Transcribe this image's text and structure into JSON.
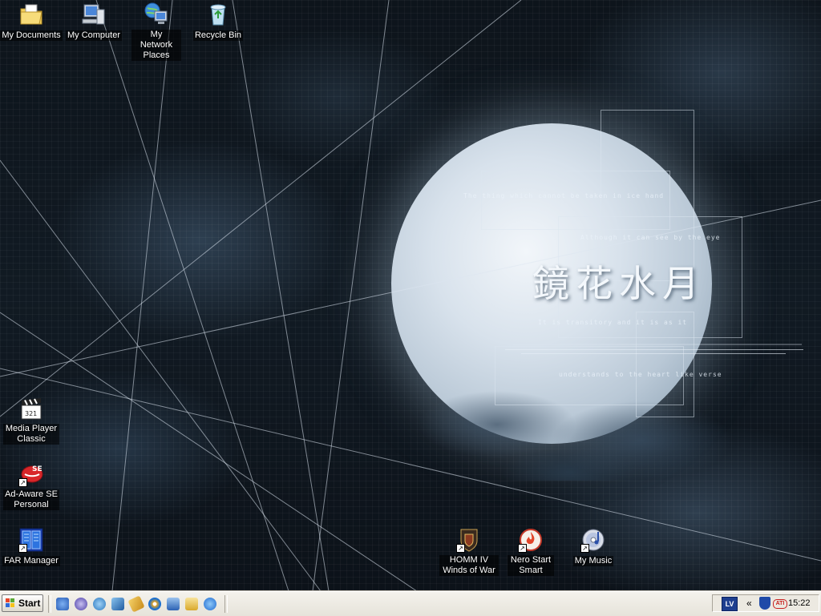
{
  "desktop": {
    "icons": [
      {
        "id": "my-documents",
        "label": "My Documents"
      },
      {
        "id": "my-computer",
        "label": "My Computer"
      },
      {
        "id": "my-network-places",
        "label": "My Network Places"
      },
      {
        "id": "recycle-bin",
        "label": "Recycle Bin"
      },
      {
        "id": "media-player-classic",
        "label": "Media Player Classic"
      },
      {
        "id": "ad-aware",
        "label": "Ad-Aware SE Personal"
      },
      {
        "id": "far-manager",
        "label": "FAR Manager"
      },
      {
        "id": "homm",
        "label": "HOMM IV Winds of War"
      },
      {
        "id": "nero",
        "label": "Nero Start Smart"
      },
      {
        "id": "my-music",
        "label": "My Music"
      }
    ],
    "wallpaper": {
      "calligraphy": "鏡花水月",
      "poem": [
        "The thing which cannot be taken in ice hand",
        "Although it can see by the eye",
        "It is transitory and it is as it",
        "understands to the heart like verse"
      ]
    }
  },
  "taskbar": {
    "start_label": "Start",
    "quick_launch": [
      "quick-launch-1",
      "quick-launch-2",
      "quick-launch-3",
      "quick-launch-4",
      "quick-launch-5",
      "quick-launch-6",
      "quick-launch-7",
      "quick-launch-8",
      "quick-launch-9"
    ],
    "tray": {
      "language": "LV",
      "expand": "«",
      "time": "15:22"
    }
  },
  "colors": {
    "taskbar_bg": "#ece9e1",
    "language_badge": "#1f3f8f"
  }
}
